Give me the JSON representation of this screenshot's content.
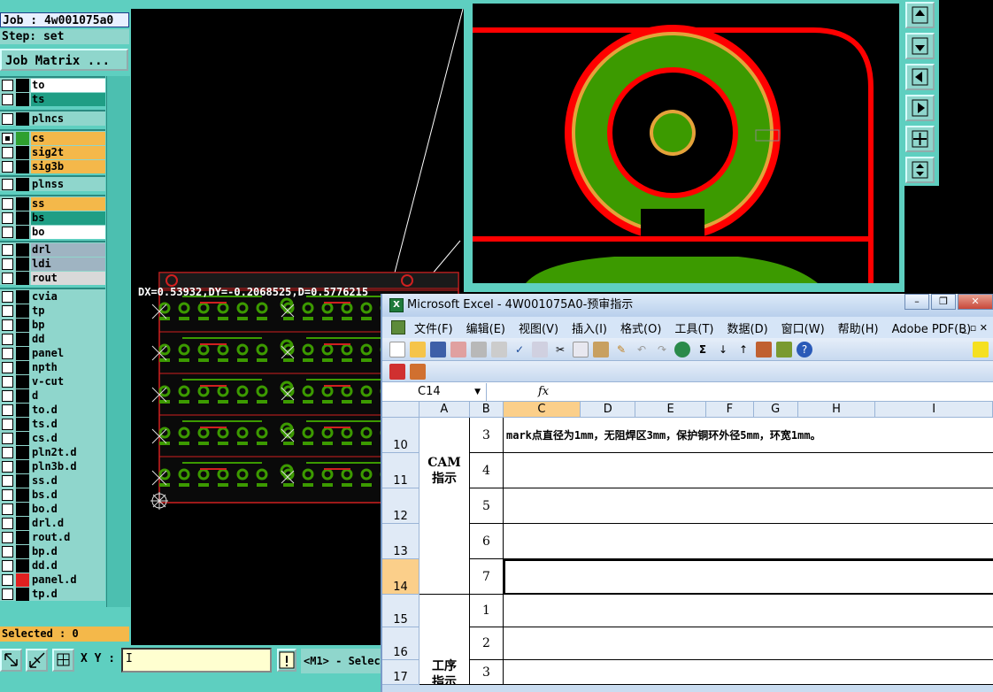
{
  "cam": {
    "job": "Job : 4w001075a0",
    "step": "Step: set",
    "job_matrix": "Job Matrix ...",
    "selected": "Selected : 0",
    "xy_label": "X Y :",
    "xy_value": "I",
    "mode_hint": "<M1> - Selec",
    "coords": "DX=0.53932,DY=-0.2068525,D=0.5776215",
    "layers": [
      {
        "name": "to",
        "color": "#ffffff"
      },
      {
        "name": "ts",
        "color": "#1f9e85"
      },
      {
        "name": "plncs",
        "color": "#8fd6cc"
      },
      {
        "name": "cs",
        "color": "#f4b84a"
      },
      {
        "name": "sig2t",
        "color": "#f4b84a"
      },
      {
        "name": "sig3b",
        "color": "#f4b84a"
      },
      {
        "name": "plnss",
        "color": "#8fd6cc"
      },
      {
        "name": "ss",
        "color": "#f4b84a"
      },
      {
        "name": "bs",
        "color": "#1f9e85"
      },
      {
        "name": "bo",
        "color": "#ffffff"
      },
      {
        "name": "drl",
        "color": "#9fb4c2"
      },
      {
        "name": "ldi",
        "color": "#9fb4c2"
      },
      {
        "name": "rout",
        "color": "#d9d9d9"
      },
      {
        "name": "cvia",
        "color": "#8fd6cc"
      },
      {
        "name": "tp",
        "color": "#8fd6cc"
      },
      {
        "name": "bp",
        "color": "#8fd6cc"
      },
      {
        "name": "dd",
        "color": "#8fd6cc"
      },
      {
        "name": "panel",
        "color": "#8fd6cc"
      },
      {
        "name": "npth",
        "color": "#8fd6cc"
      },
      {
        "name": "v-cut",
        "color": "#8fd6cc"
      },
      {
        "name": "d",
        "color": "#8fd6cc"
      },
      {
        "name": "to.d",
        "color": "#8fd6cc"
      },
      {
        "name": "ts.d",
        "color": "#8fd6cc"
      },
      {
        "name": "cs.d",
        "color": "#8fd6cc"
      },
      {
        "name": "pln2t.d",
        "color": "#8fd6cc"
      },
      {
        "name": "pln3b.d",
        "color": "#8fd6cc"
      },
      {
        "name": "ss.d",
        "color": "#8fd6cc"
      },
      {
        "name": "bs.d",
        "color": "#8fd6cc"
      },
      {
        "name": "bo.d",
        "color": "#8fd6cc"
      },
      {
        "name": "drl.d",
        "color": "#8fd6cc"
      },
      {
        "name": "rout.d",
        "color": "#8fd6cc"
      },
      {
        "name": "bp.d",
        "color": "#8fd6cc"
      },
      {
        "name": "dd.d",
        "color": "#8fd6cc"
      },
      {
        "name": "panel.d",
        "color": "#8fd6cc"
      },
      {
        "name": "tp.d",
        "color": "#8fd6cc"
      }
    ]
  },
  "excel": {
    "title": "Microsoft Excel - 4W001075A0-预审指示",
    "menu": [
      "文件(F)",
      "编辑(E)",
      "视图(V)",
      "插入(I)",
      "格式(O)",
      "工具(T)",
      "数据(D)",
      "窗口(W)",
      "帮助(H)",
      "Adobe PDF(B)"
    ],
    "name_box": "C14",
    "fx": "fx",
    "columns": [
      "A",
      "B",
      "C",
      "D",
      "E",
      "F",
      "G",
      "H",
      "I"
    ],
    "rows": [
      "10",
      "11",
      "12",
      "13",
      "14",
      "15",
      "16",
      "17"
    ],
    "cam_label": "CAM\n指示",
    "proc_label": "工序\n指示",
    "b_values": [
      "3",
      "4",
      "5",
      "6",
      "7",
      "1",
      "2",
      "3"
    ],
    "c10": "mark点直径为1mm，无阻焊区3mm，保护铜环外径5mm，环宽1mm。"
  }
}
